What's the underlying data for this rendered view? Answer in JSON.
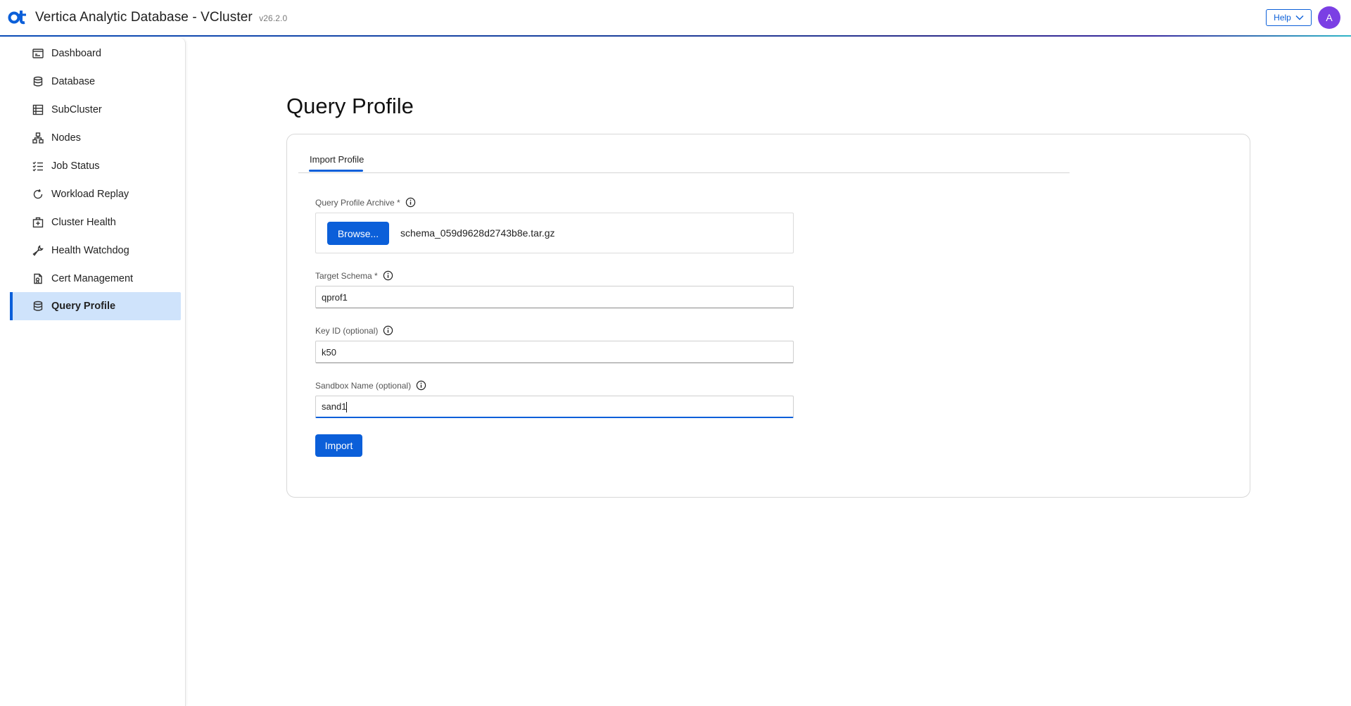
{
  "header": {
    "title": "Vertica Analytic Database - VCluster",
    "version": "v26.2.0",
    "help_label": "Help",
    "avatar_initial": "A",
    "brand_color": "#0b5fd9"
  },
  "sidebar": {
    "items": [
      {
        "label": "Dashboard",
        "icon": "dashboard-icon"
      },
      {
        "label": "Database",
        "icon": "database-icon"
      },
      {
        "label": "SubCluster",
        "icon": "subcluster-icon"
      },
      {
        "label": "Nodes",
        "icon": "nodes-icon"
      },
      {
        "label": "Job Status",
        "icon": "checklist-icon"
      },
      {
        "label": "Workload Replay",
        "icon": "replay-icon"
      },
      {
        "label": "Cluster Health",
        "icon": "health-kit-icon"
      },
      {
        "label": "Health Watchdog",
        "icon": "wrench-icon"
      },
      {
        "label": "Cert Management",
        "icon": "certificate-icon"
      },
      {
        "label": "Query Profile",
        "icon": "database-icon",
        "active": true
      }
    ]
  },
  "main": {
    "page_title": "Query Profile",
    "tabs": [
      {
        "label": "Import Profile",
        "active": true
      }
    ],
    "form": {
      "archive": {
        "label": "Query Profile Archive *",
        "browse_label": "Browse...",
        "file_name": "schema_059d9628d2743b8e.tar.gz"
      },
      "target_schema": {
        "label": "Target Schema *",
        "value": "qprof1"
      },
      "key_id": {
        "label": "Key ID (optional)",
        "value": "k50"
      },
      "sandbox_name": {
        "label": "Sandbox Name (optional)",
        "value": "sand1"
      },
      "import_label": "Import"
    }
  }
}
